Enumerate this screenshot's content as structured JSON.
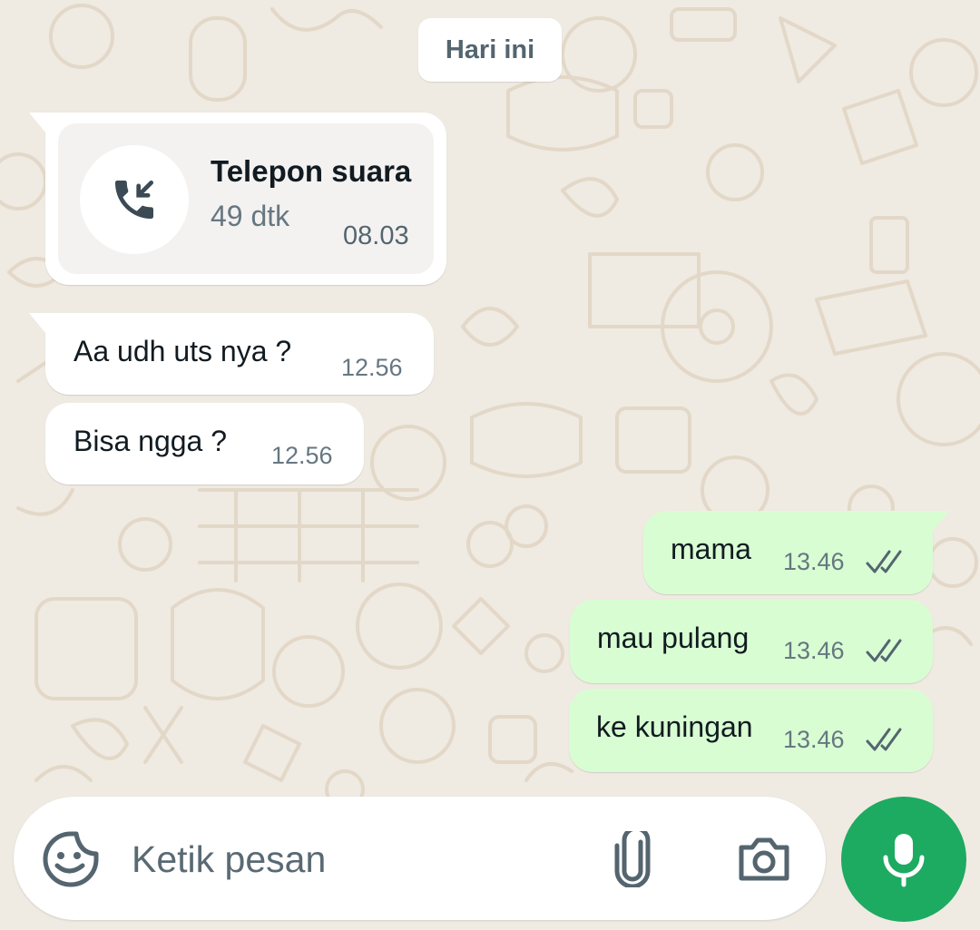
{
  "chat": {
    "date_label": "Hari ini",
    "call": {
      "title": "Telepon suara",
      "duration": "49 dtk",
      "time": "08.03",
      "icon": "incoming-call-icon"
    },
    "messages": [
      {
        "direction": "in",
        "text": "Aa udh uts nya ?",
        "time": "12.56"
      },
      {
        "direction": "in",
        "text": "Bisa ngga ?",
        "time": "12.56"
      },
      {
        "direction": "out",
        "text": "mama",
        "time": "13.46",
        "status": "read"
      },
      {
        "direction": "out",
        "text": "mau pulang",
        "time": "13.46",
        "status": "read"
      },
      {
        "direction": "out",
        "text": "ke kuningan",
        "time": "13.46",
        "status": "read"
      }
    ]
  },
  "composer": {
    "placeholder": "Ketik pesan",
    "sticker_icon": "sticker-icon",
    "attach_icon": "paperclip-icon",
    "camera_icon": "camera-icon",
    "mic_icon": "microphone-icon"
  },
  "colors": {
    "background": "#efeae2",
    "incoming_bubble": "#ffffff",
    "outgoing_bubble": "#d9fdd3",
    "accent_green": "#1daa61",
    "read_ticks": "#54656f"
  }
}
